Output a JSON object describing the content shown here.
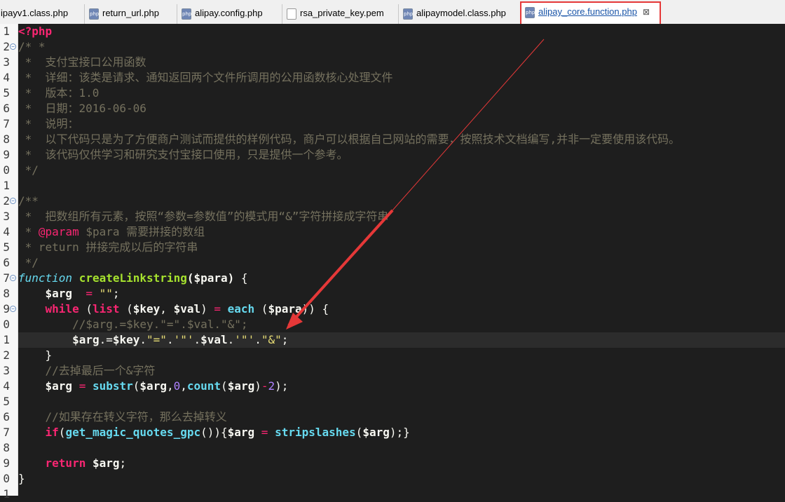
{
  "tabs": [
    {
      "label": "ipayv1.class.php",
      "icon": "php-file-icon"
    },
    {
      "label": "return_url.php",
      "icon": "php-file-icon"
    },
    {
      "label": "alipay.config.php",
      "icon": "php-file-icon"
    },
    {
      "label": "rsa_private_key.pem",
      "icon": "text-file-icon"
    },
    {
      "label": "alipaymodel.class.php",
      "icon": "php-file-icon"
    },
    {
      "label": "alipay_core.function.php",
      "icon": "php-file-icon",
      "active": true,
      "close": "⊠"
    }
  ],
  "icon_text": {
    "php": "php"
  },
  "line_numbers": [
    "1",
    "2",
    "3",
    "4",
    "5",
    "6",
    "7",
    "8",
    "9",
    "0",
    "1",
    "2",
    "3",
    "4",
    "5",
    "6",
    "7",
    "8",
    "9",
    "0",
    "1",
    "2",
    "3",
    "4",
    "5",
    "6",
    "7",
    "8",
    "9",
    "0",
    "1"
  ],
  "code": [
    [
      [
        "tag",
        "<?php"
      ]
    ],
    [
      [
        "doc",
        "/* *"
      ]
    ],
    [
      [
        "doc",
        " *  支付宝接口公用函数"
      ]
    ],
    [
      [
        "doc",
        " *  详细：该类是请求、通知返回两个文件所调用的公用函数核心处理文件"
      ]
    ],
    [
      [
        "doc",
        " *  版本：1.0"
      ]
    ],
    [
      [
        "doc",
        " *  日期：2016-06-06"
      ]
    ],
    [
      [
        "doc",
        " *  说明："
      ]
    ],
    [
      [
        "doc",
        " *  以下代码只是为了方便商户测试而提供的样例代码，商户可以根据自己网站的需要，按照技术文档编写,并非一定要使用该代码。"
      ]
    ],
    [
      [
        "doc",
        " *  该代码仅供学习和研究支付宝接口使用，只是提供一个参考。"
      ]
    ],
    [
      [
        "doc",
        " */"
      ]
    ],
    [],
    [
      [
        "doc",
        "/**"
      ]
    ],
    [
      [
        "doc",
        " *  把数组所有元素，按照“参数=参数值”的模式用“&”字符拼接成字符串"
      ]
    ],
    [
      [
        "doc",
        " * "
      ],
      [
        "ann",
        "@param"
      ],
      [
        "doc",
        " $para 需要拼接的数组"
      ]
    ],
    [
      [
        "doc",
        " * return 拼接完成以后的字符串"
      ]
    ],
    [
      [
        "doc",
        " */"
      ]
    ],
    [
      [
        "fnkw",
        "function"
      ],
      [
        "plain",
        " "
      ],
      [
        "fn",
        "createLinkstring"
      ],
      [
        "var",
        "($para)"
      ],
      [
        "plain",
        " {"
      ]
    ],
    [
      [
        "plain",
        "    "
      ],
      [
        "var",
        "$arg"
      ],
      [
        "plain",
        "  "
      ],
      [
        "op",
        "="
      ],
      [
        "plain",
        " "
      ],
      [
        "str",
        "\"\""
      ],
      [
        "plain",
        ";"
      ]
    ],
    [
      [
        "plain",
        "    "
      ],
      [
        "kw",
        "while"
      ],
      [
        "plain",
        " ("
      ],
      [
        "kw",
        "list"
      ],
      [
        "plain",
        " ("
      ],
      [
        "var",
        "$key"
      ],
      [
        "plain",
        ", "
      ],
      [
        "var",
        "$val"
      ],
      [
        "plain",
        ") "
      ],
      [
        "op",
        "="
      ],
      [
        "plain",
        " "
      ],
      [
        "bi",
        "each"
      ],
      [
        "plain",
        " ("
      ],
      [
        "var",
        "$para"
      ],
      [
        "plain",
        ")) {"
      ]
    ],
    [
      [
        "plain",
        "        "
      ],
      [
        "cmt2",
        "//$arg.=$key.\"=\".$val.\"&\";"
      ]
    ],
    [
      [
        "plain",
        "        "
      ],
      [
        "var",
        "$arg"
      ],
      [
        "plain",
        ".="
      ],
      [
        "var",
        "$key"
      ],
      [
        "plain",
        "."
      ],
      [
        "str",
        "\"=\""
      ],
      [
        "plain",
        "."
      ],
      [
        "str",
        "'\"'"
      ],
      [
        "plain",
        "."
      ],
      [
        "var",
        "$val"
      ],
      [
        "plain",
        "."
      ],
      [
        "str",
        "'\"'"
      ],
      [
        "plain",
        "."
      ],
      [
        "str",
        "\"&\""
      ],
      [
        "plain",
        ";"
      ]
    ],
    [
      [
        "plain",
        "    }"
      ]
    ],
    [
      [
        "plain",
        "    "
      ],
      [
        "cmt2",
        "//去掉最后一个&字符"
      ]
    ],
    [
      [
        "plain",
        "    "
      ],
      [
        "var",
        "$arg"
      ],
      [
        "plain",
        " "
      ],
      [
        "op",
        "="
      ],
      [
        "plain",
        " "
      ],
      [
        "bi",
        "substr"
      ],
      [
        "plain",
        "("
      ],
      [
        "var",
        "$arg"
      ],
      [
        "plain",
        ","
      ],
      [
        "num",
        "0"
      ],
      [
        "plain",
        ","
      ],
      [
        "bi",
        "count"
      ],
      [
        "plain",
        "("
      ],
      [
        "var",
        "$arg"
      ],
      [
        "plain",
        ")"
      ],
      [
        "op",
        "-"
      ],
      [
        "num",
        "2"
      ],
      [
        "plain",
        ");"
      ]
    ],
    [],
    [
      [
        "plain",
        "    "
      ],
      [
        "cmt2",
        "//如果存在转义字符，那么去掉转义"
      ]
    ],
    [
      [
        "plain",
        "    "
      ],
      [
        "kw",
        "if"
      ],
      [
        "plain",
        "("
      ],
      [
        "bi",
        "get_magic_quotes_gpc"
      ],
      [
        "plain",
        "()){"
      ],
      [
        "var",
        "$arg"
      ],
      [
        "plain",
        " "
      ],
      [
        "op",
        "="
      ],
      [
        "plain",
        " "
      ],
      [
        "bi",
        "stripslashes"
      ],
      [
        "plain",
        "("
      ],
      [
        "var",
        "$arg"
      ],
      [
        "plain",
        ");}"
      ]
    ],
    [],
    [
      [
        "plain",
        "    "
      ],
      [
        "kw",
        "return"
      ],
      [
        "plain",
        " "
      ],
      [
        "var",
        "$arg"
      ],
      [
        "plain",
        ";"
      ]
    ],
    [
      [
        "plain",
        "}"
      ]
    ],
    []
  ],
  "current_line_index": 20,
  "fold_lines": [
    1,
    11,
    16,
    18
  ],
  "colors": {
    "annotation": "#e53838",
    "editor_bg": "#1e1e1e",
    "active_tab_text": "#1a55a8"
  }
}
